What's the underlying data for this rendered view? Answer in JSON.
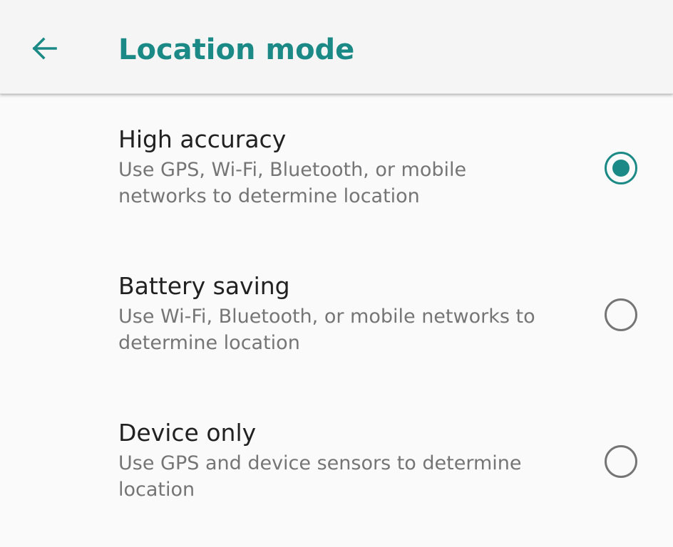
{
  "app_bar": {
    "title": "Location mode",
    "back_icon": "arrow-left-icon"
  },
  "colors": {
    "accent": "#1b8a86",
    "title_text": "#212121",
    "summary_text": "#757575",
    "background": "#fafafa",
    "app_bar_background": "#f5f5f5"
  },
  "options": [
    {
      "title": "High accuracy",
      "summary_line1": "Use GPS, Wi-Fi, Bluetooth, or mobile",
      "summary_line2": "networks to determine location",
      "selected": true
    },
    {
      "title": "Battery saving",
      "summary_line1": "Use Wi-Fi, Bluetooth, or mobile networks to",
      "summary_line2": "determine location",
      "selected": false
    },
    {
      "title": "Device only",
      "summary_line1": "Use GPS and device sensors to determine",
      "summary_line2": "location",
      "selected": false
    }
  ]
}
